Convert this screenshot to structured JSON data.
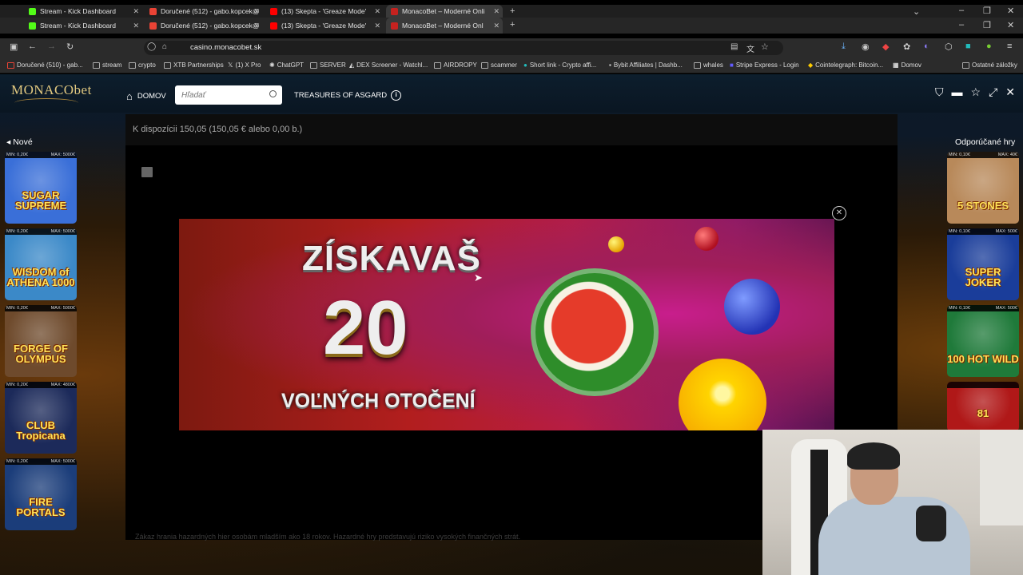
{
  "browser": {
    "tabs_row1": [
      {
        "title": "Stream - Kick Dashboard",
        "color": "#53fc18"
      },
      {
        "title": "Doručené (512) - gabo.kopcek@",
        "color": "#ea4335"
      },
      {
        "title": "(13) Skepta - 'Greaze Mode'",
        "color": "#ff0000"
      },
      {
        "title": "MonacoBet – Moderné Onli",
        "color": "#c5221f"
      }
    ],
    "tabs_row2": [
      {
        "title": "Stream - Kick Dashboard",
        "color": "#53fc18"
      },
      {
        "title": "Doručené (512) - gabo.kopcek@",
        "color": "#ea4335"
      },
      {
        "title": "(13) Skepta - 'Greaze Mode'",
        "color": "#ff0000"
      },
      {
        "title": "MonacoBet – Moderné Onl",
        "color": "#c5221f"
      }
    ],
    "url": "casino.monacobet.sk",
    "bookmarks": [
      "Doručené (510) - gab...",
      "stream",
      "crypto",
      "XTB Partnerships",
      "(1) X Pro",
      "ChatGPT",
      "SERVER",
      "DEX Screener - Watchl...",
      "AIRDROPY",
      "scammer",
      "Short link - Crypto affi...",
      "Bybit Affiliates | Dashb...",
      "whales",
      "Stripe Express - Login",
      "Cointelegraph: Bitcoin...",
      "Domov"
    ],
    "other_bookmarks": "Ostatné záložky"
  },
  "site": {
    "logo": "MONACObet",
    "nav_home": "DOMOV",
    "search_placeholder": "Hľadať",
    "game_title": "TREASURES OF ASGARD",
    "left_label": "Nové",
    "right_label": "Odporúčané hry",
    "balance": "K dispozícii 150,05 (150,05 € alebo 0,00 b.)",
    "disclaimer": "Zákaz hrania hazardných hier osobám mladším ako 18 rokov. Hazardné hry predstavujú riziko vysokých finančných strát."
  },
  "left_games": [
    {
      "min": "MIN: 0,20€",
      "max": "MAX: 5000€",
      "title": "SUGAR SUPREME",
      "bg": "#3a6fd8"
    },
    {
      "min": "MIN: 0,20€",
      "max": "MAX: 5000€",
      "title": "WISDOM of ATHENA 1000",
      "bg": "#3b89c8"
    },
    {
      "min": "MIN: 0,20€",
      "max": "MAX: 5000€",
      "title": "FORGE OF OLYMPUS",
      "bg": "#6e4a2c"
    },
    {
      "min": "MIN: 0,20€",
      "max": "MAX: 4800€",
      "title": "CLUB Tropicana",
      "bg": "#1c2a5a"
    },
    {
      "min": "MIN: 0,20€",
      "max": "MAX: 5000€",
      "title": "FIRE PORTALS",
      "bg": "#1b3d7a"
    }
  ],
  "right_games": [
    {
      "min": "MIN: 0,10€",
      "max": "MAX: 40€",
      "title": "5 STONES",
      "bg": "#b8895a"
    },
    {
      "min": "MIN: 0,10€",
      "max": "MAX: 500€",
      "title": "SUPER JOKER",
      "bg": "#1a3d9a"
    },
    {
      "min": "MIN: 0,10€",
      "max": "MAX: 500€",
      "title": "100 HOT WILD",
      "bg": "#1f7a3a"
    },
    {
      "min": "",
      "max": "",
      "title": "81",
      "bg": "#b01818"
    }
  ],
  "banner": {
    "line1": "ZÍSKAVAŠ",
    "number": "20",
    "line2": "VOĽNÝCH OTOČENÍ"
  }
}
